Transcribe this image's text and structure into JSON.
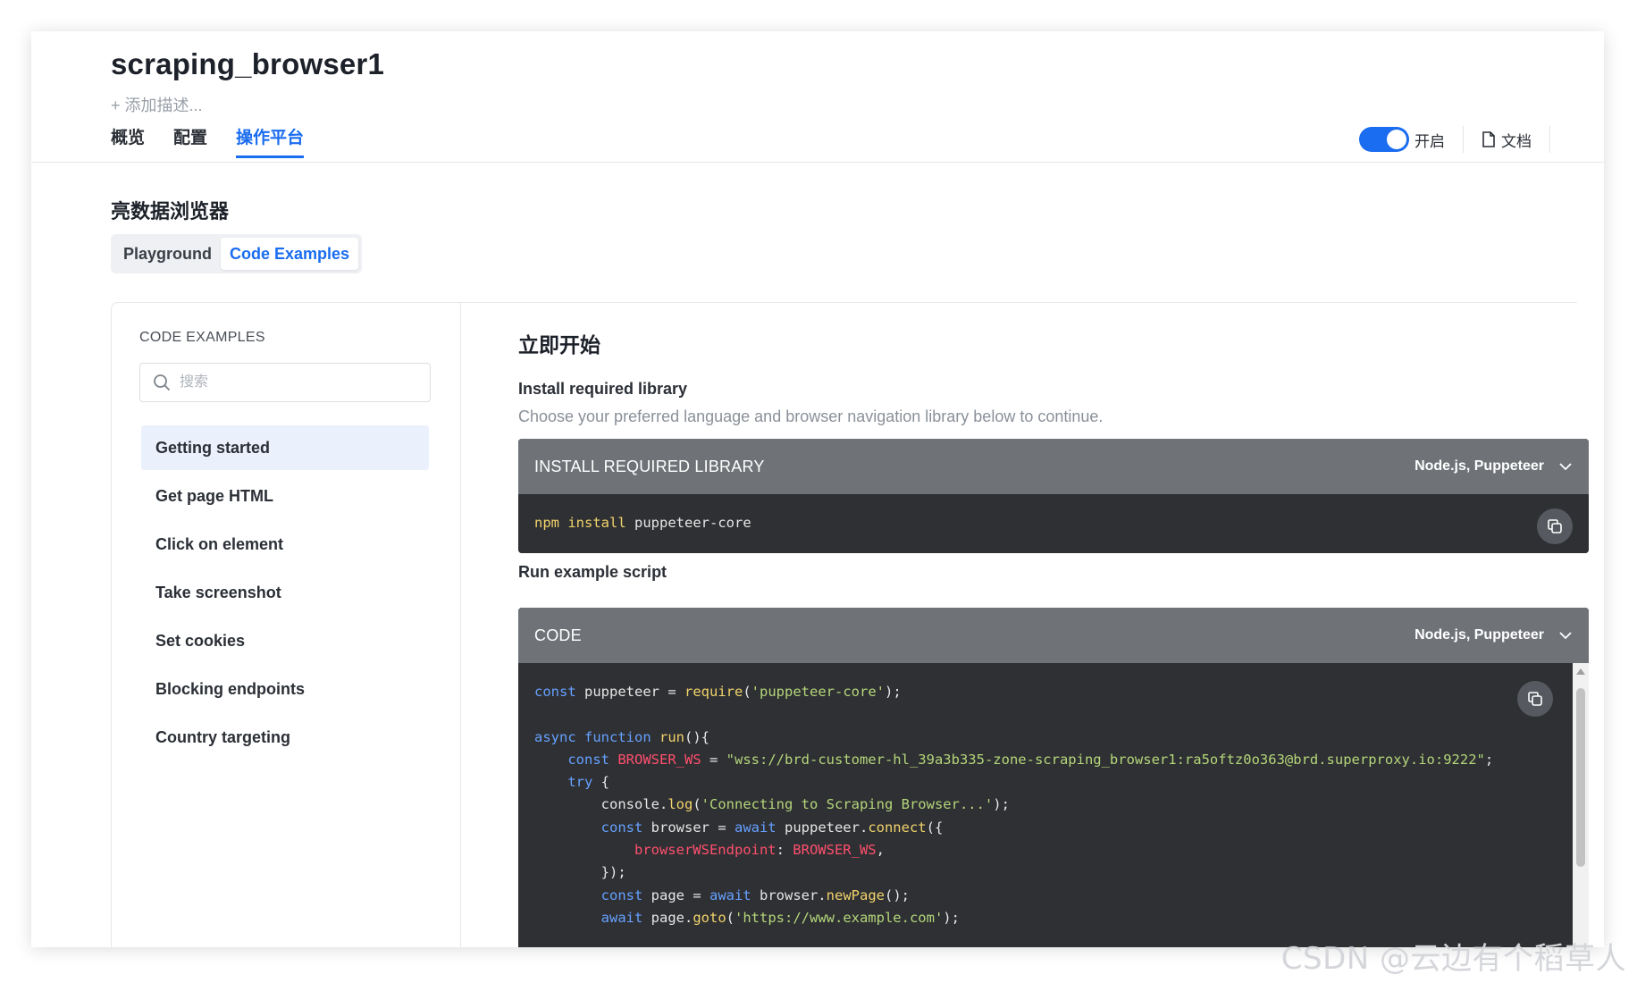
{
  "header": {
    "title": "scraping_browser1",
    "add_description": "+ 添加描述...",
    "tabs": [
      {
        "label": "概览",
        "active": false
      },
      {
        "label": "配置",
        "active": false
      },
      {
        "label": "操作平台",
        "active": true
      }
    ],
    "toggle": {
      "label": "开启",
      "on": true
    },
    "docs_label": "文档"
  },
  "section": {
    "title": "亮数据浏览器",
    "segments": [
      {
        "label": "Playground",
        "active": false
      },
      {
        "label": "Code Examples",
        "active": true
      }
    ]
  },
  "sidebar": {
    "heading": "CODE EXAMPLES",
    "search_placeholder": "搜索",
    "items": [
      {
        "label": "Getting started",
        "active": true
      },
      {
        "label": "Get page HTML",
        "active": false
      },
      {
        "label": "Click on element",
        "active": false
      },
      {
        "label": "Take screenshot",
        "active": false
      },
      {
        "label": "Set cookies",
        "active": false
      },
      {
        "label": "Blocking endpoints",
        "active": false
      },
      {
        "label": "Country targeting",
        "active": false
      }
    ]
  },
  "content": {
    "title": "立即开始",
    "install_heading": "Install required library",
    "install_desc": "Choose your preferred language and browser navigation library below to continue.",
    "install_card": {
      "title": "INSTALL REQUIRED LIBRARY",
      "language": "Node.js, Puppeteer",
      "code": "npm install puppeteer-core"
    },
    "run_heading": "Run example script",
    "code_card": {
      "title": "CODE",
      "language": "Node.js, Puppeteer",
      "lines": [
        "const puppeteer = require('puppeteer-core');",
        "",
        "async function run(){",
        "    const BROWSER_WS = \"wss://brd-customer-hl_39a3b335-zone-scraping_browser1:ra5oftz0o363@brd.superproxy.io:9222\";",
        "    try {",
        "        console.log('Connecting to Scraping Browser...');",
        "        const browser = await puppeteer.connect({",
        "            browserWSEndpoint: BROWSER_WS,",
        "        });",
        "        const page = await browser.newPage();",
        "        await page.goto('https://www.example.com');"
      ]
    }
  },
  "watermark": "CSDN @云边有个稻草人",
  "colors": {
    "accent": "#1a6cf0",
    "code_bg": "#2e3033",
    "card_header": "#6f7378",
    "keyword": "#66a0ff",
    "string": "#b5d67a",
    "function": "#f2d36b",
    "constant": "#ff4f6e"
  },
  "icons": [
    "search-icon",
    "document-icon",
    "chevron-down-icon",
    "copy-icon"
  ]
}
